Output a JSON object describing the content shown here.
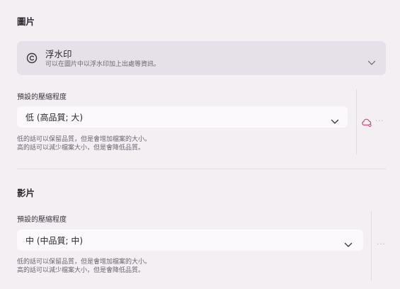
{
  "images_section": {
    "title": "圖片",
    "watermark": {
      "title": "浮水印",
      "description": "可以在圖片中以浮水印加上出處等資訊。",
      "icon": "copyright-icon"
    },
    "compression_label": "預設的壓縮程度",
    "compression_value": "低 (高品質; 大)",
    "help_line_1": "低的話可以保留品質，但是會增加檔案的大小。",
    "help_line_2": "高的話可以減少檔案大小，但是會降低品質。",
    "sync_icon": "cloud-sync-icon",
    "more_label": "···"
  },
  "video_section": {
    "title": "影片",
    "compression_label": "預設的壓縮程度",
    "compression_value": "中 (中品質; 中)",
    "help_line_1": "低的話可以保留品質，但是會增加檔案的大小。",
    "help_line_2": "高的話可以減少檔案大小，但是會降低品質。",
    "more_label": "···"
  },
  "colors": {
    "background": "#f3eff3",
    "card": "#e6e0e8",
    "select": "#fbf9fb",
    "accent": "#c0527a"
  }
}
